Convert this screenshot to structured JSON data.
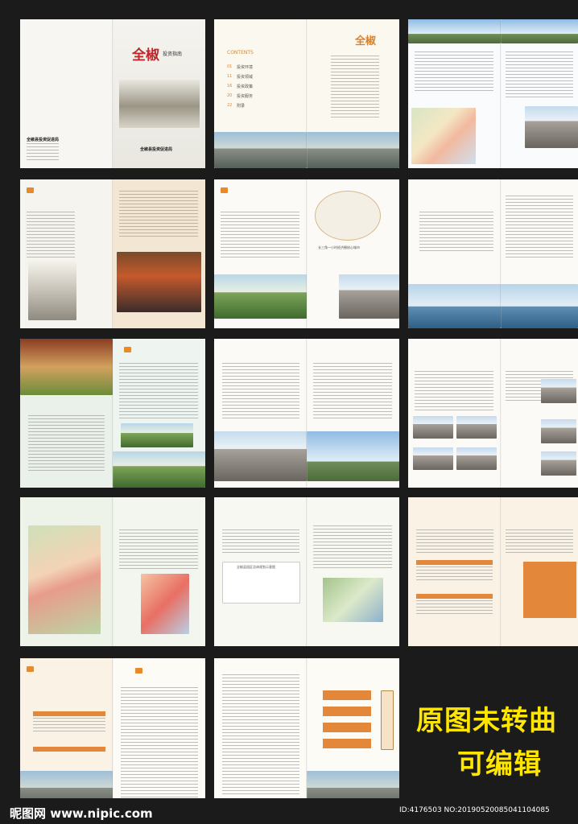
{
  "cover": {
    "title_cn": "全椒",
    "subtitle_cn": "投资指南",
    "left_label": "全椒县投资促进局",
    "right_label": "全椒县投资促进局"
  },
  "contents": {
    "heading": "CONTENTS",
    "logo_cn": "全椒",
    "items": [
      {
        "num": "01",
        "label": "投资环境"
      },
      {
        "num": "11",
        "label": "投资领域"
      },
      {
        "num": "16",
        "label": "投资政策"
      },
      {
        "num": "20",
        "label": "投资服务"
      },
      {
        "num": "22",
        "label": "附录"
      }
    ]
  },
  "misc_labels": {
    "map_caption": "全椒县园区总体规划示意图",
    "region_caption": "长三角一小时经济圈核心城市"
  },
  "watermark": {
    "site": "昵图网 www.nipic.com",
    "id_text": "ID:4176503 NO:20190520085041104085"
  },
  "overlay": {
    "line1": "原图未转曲",
    "line2": "可编辑"
  },
  "colors": {
    "accent": "#e3873a",
    "title_red": "#c0262a",
    "overlay_yellow": "#ffe600",
    "background": "#1b1b1b"
  }
}
